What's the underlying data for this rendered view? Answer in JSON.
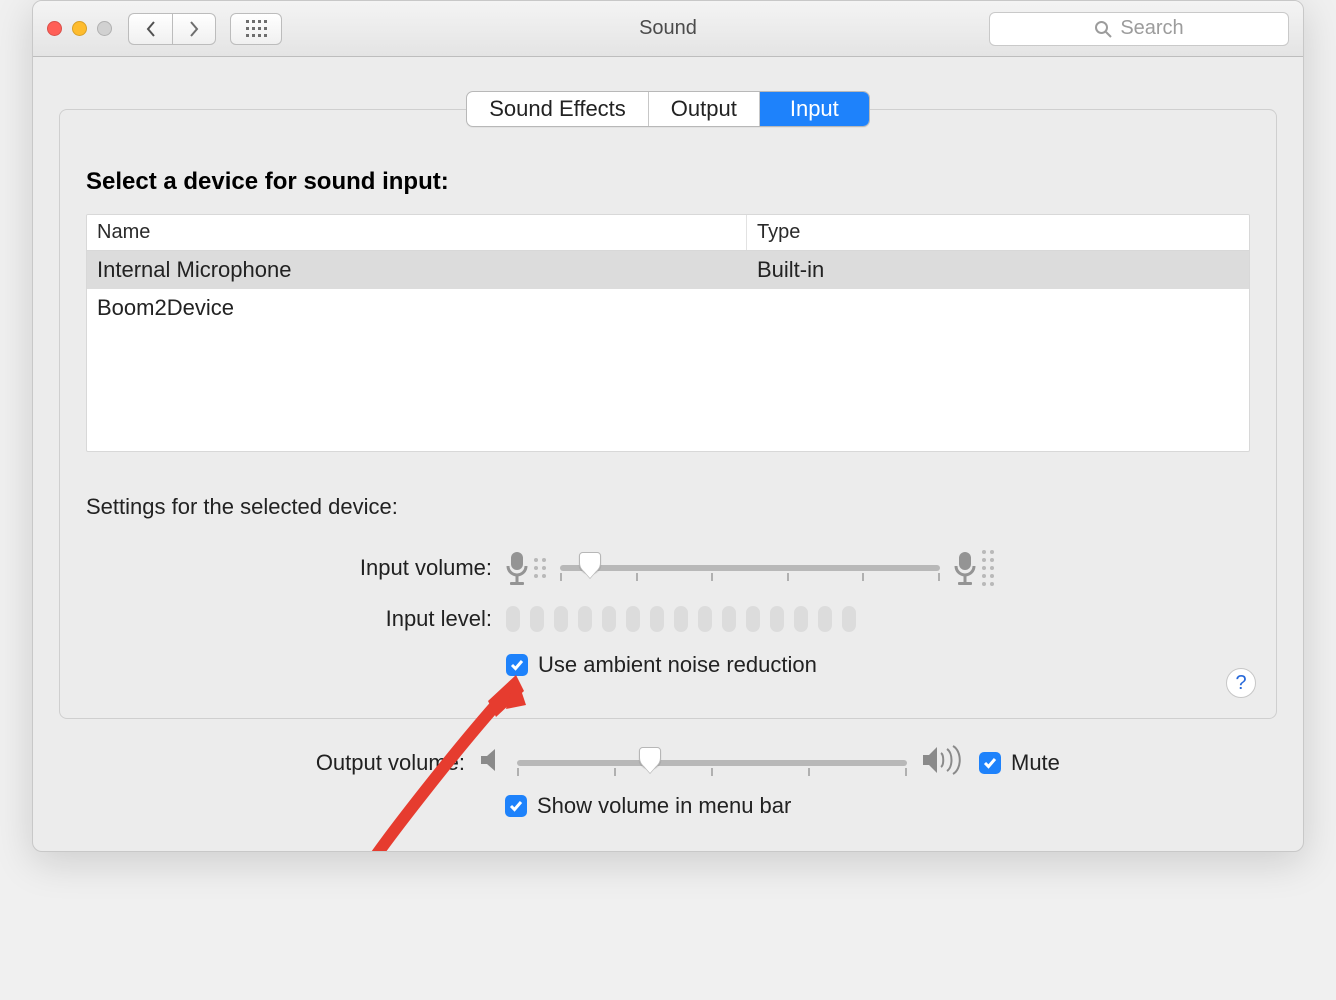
{
  "colors": {
    "accent": "#1e82fb",
    "arrow": "#e63c2f"
  },
  "toolbar": {
    "searchPlaceholder": "Search",
    "title": "Sound"
  },
  "tabs": {
    "items": [
      "Sound Effects",
      "Output",
      "Input"
    ],
    "activeIndex": 2
  },
  "inputPanel": {
    "heading": "Select a device for sound input:",
    "columns": {
      "name": "Name",
      "type": "Type"
    },
    "devices": [
      {
        "name": "Internal Microphone",
        "type": "Built-in",
        "selected": true
      },
      {
        "name": "Boom2Device",
        "type": "",
        "selected": false
      }
    ],
    "settingsHeading": "Settings for the selected device:",
    "labels": {
      "inputVolume": "Input volume:",
      "inputLevel": "Input level:",
      "ambient": "Use ambient noise reduction",
      "outputVolume": "Output volume:",
      "mute": "Mute",
      "showMenuBar": "Show volume in menu bar"
    },
    "values": {
      "inputVolumePercent": 8,
      "inputLevelSegments": 15,
      "inputLevelActive": 0,
      "ambientChecked": true,
      "outputVolumePercent": 34,
      "muteChecked": true,
      "showMenuBarChecked": true
    }
  }
}
